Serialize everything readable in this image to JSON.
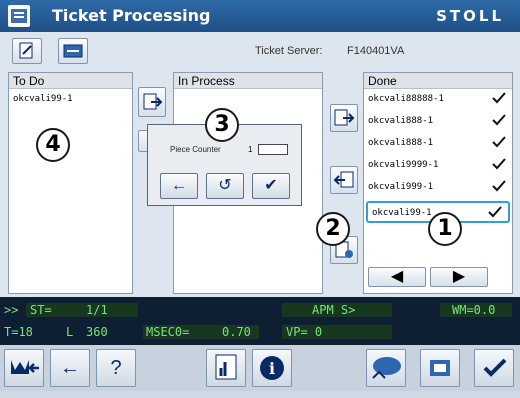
{
  "header": {
    "title": "Ticket Processing",
    "brand": "STOLL"
  },
  "server": {
    "label": "Ticket Server:",
    "value": "F140401VA"
  },
  "todo": {
    "title": "To Do",
    "items": [
      "okcvali99-1"
    ]
  },
  "inprocess": {
    "title": "In Process"
  },
  "done": {
    "title": "Done",
    "items": [
      "okcvali88888-1",
      "okcvali888-1",
      "okcvali888-1",
      "okcvali9999-1",
      "okcvali999-1",
      "okcvali99-1"
    ]
  },
  "dialog": {
    "label": "Piece Counter",
    "value": "1"
  },
  "markers": [
    "1",
    "2",
    "3",
    "4"
  ],
  "status": {
    "prefix": ">>",
    "st_label": "ST=",
    "st_value": "1/1",
    "apm": "APM S>",
    "wm": "WM=0.0",
    "t": "T=18",
    "l": "L",
    "l_value": "360",
    "msec_label": "MSEC0=",
    "msec_value": "0.70",
    "vp": "VP= 0"
  },
  "bottom": {
    "help": "?",
    "info": "i"
  }
}
